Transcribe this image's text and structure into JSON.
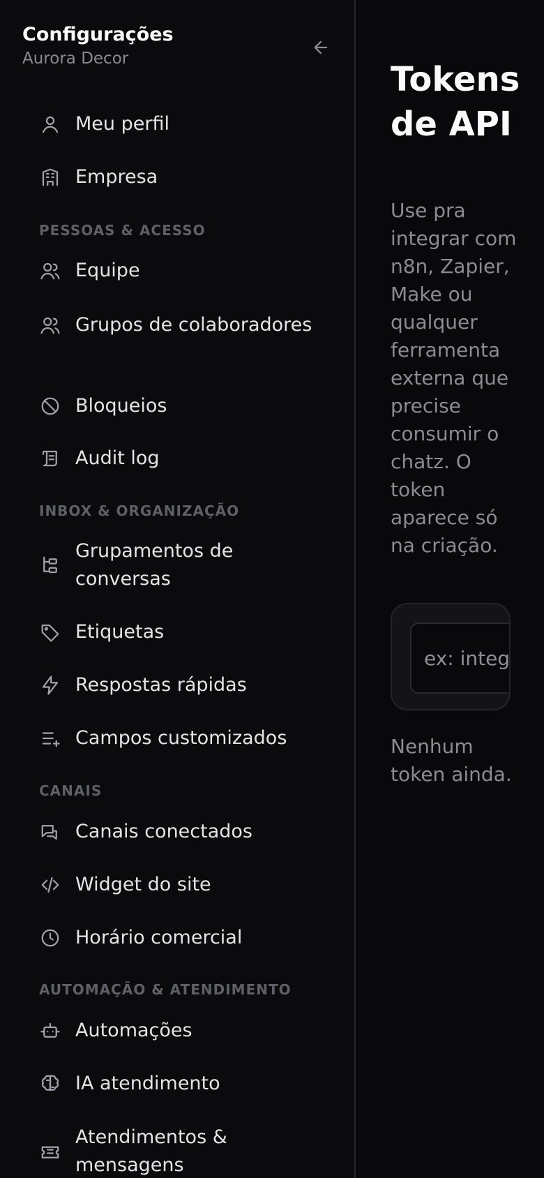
{
  "sidebar": {
    "title": "Configurações",
    "subtitle": "Aurora Decor",
    "back_icon": "arrow-left-icon",
    "top_items": [
      {
        "label": "Meu perfil",
        "icon": "user-icon"
      },
      {
        "label": "Empresa",
        "icon": "building-icon"
      }
    ],
    "sections": [
      {
        "label": "PESSOAS & ACESSO",
        "items": [
          {
            "label": "Equipe",
            "icon": "users-icon"
          },
          {
            "label": "Grupos de colaboradores",
            "icon": "users-group-icon"
          },
          {
            "label": "Bloqueios",
            "icon": "ban-icon"
          },
          {
            "label": "Audit log",
            "icon": "scroll-icon"
          }
        ]
      },
      {
        "label": "INBOX & ORGANIZAÇÃO",
        "items": [
          {
            "label": "Grupamentos de conversas",
            "icon": "folder-tree-icon"
          },
          {
            "label": "Etiquetas",
            "icon": "tag-icon"
          },
          {
            "label": "Respostas rápidas",
            "icon": "zap-icon"
          },
          {
            "label": "Campos customizados",
            "icon": "list-plus-icon"
          }
        ]
      },
      {
        "label": "CANAIS",
        "items": [
          {
            "label": "Canais conectados",
            "icon": "messages-icon"
          },
          {
            "label": "Widget do site",
            "icon": "code-icon"
          },
          {
            "label": "Horário comercial",
            "icon": "clock-icon"
          }
        ]
      },
      {
        "label": "AUTOMAÇÃO & ATENDIMENTO",
        "items": [
          {
            "label": "Automações",
            "icon": "bot-icon"
          },
          {
            "label": "IA atendimento",
            "icon": "brain-icon"
          },
          {
            "label": "Atendimentos & mensagens",
            "icon": "ticket-icon"
          }
        ]
      }
    ]
  },
  "main": {
    "title": "Tokens de API",
    "description": "Use pra integrar com n8n, Zapier, Make ou qualquer ferramenta externa que precise consumir o chatz. O token aparece só na criação.",
    "token_name_placeholder": "ex: integração",
    "empty_state": "Nenhum token ainda."
  },
  "colors": {
    "background": "#09090b",
    "sidebar_background": "#0b0b0d",
    "text_primary": "#fafafa",
    "text_secondary": "#8b8b93",
    "section_label": "#5f5f68",
    "border": "#27272a",
    "card_background": "#141416"
  }
}
